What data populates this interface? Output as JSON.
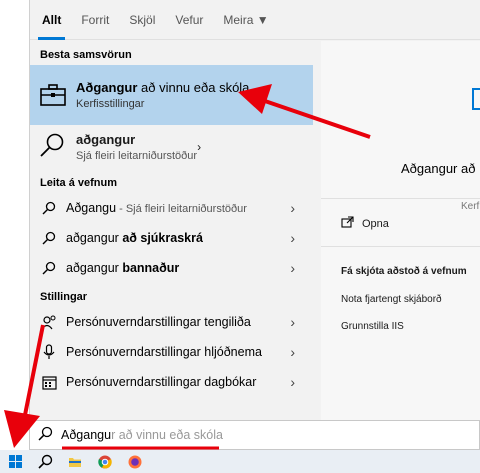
{
  "tabs": [
    {
      "label": "Allt",
      "active": true
    },
    {
      "label": "Forrit",
      "active": false
    },
    {
      "label": "Skjöl",
      "active": false
    },
    {
      "label": "Vefur",
      "active": false
    },
    {
      "label": "Meira ▼",
      "active": false
    }
  ],
  "best_match": {
    "section": "Besta samsvörun",
    "title_bold": "Aðgangur",
    "title_rest": " að vinnu eða skóla",
    "subtitle": "Kerfisstillingar"
  },
  "first_result": {
    "title": "aðgangur",
    "subtitle": "Sjá fleiri leitarniðurstöður"
  },
  "web": {
    "section": "Leita á vefnum",
    "items": [
      {
        "main": "Aðgangu",
        "extra": " - Sjá fleiri leitarniðurstöður"
      },
      {
        "main": "aðgangur ",
        "bold": "að sjúkraskrá"
      },
      {
        "main": "aðgangur ",
        "bold": "bannaður"
      }
    ]
  },
  "settings": {
    "section": "Stillingar",
    "items": [
      {
        "label": "Persónuverndarstillingar tengiliða",
        "icon": "contacts-icon"
      },
      {
        "label": "Persónuverndarstillingar hljóðnema",
        "icon": "microphone-icon"
      },
      {
        "label": "Persónuverndarstillingar dagbókar",
        "icon": "calendar-icon"
      }
    ]
  },
  "preview": {
    "title": "Aðgangur að",
    "subtitle": "Kerfi",
    "open": "Opna",
    "web_header": "Fá skjóta aðstoð á vefnum",
    "links": [
      "Nota fjartengt skjáborð",
      "Grunnstilla IIS"
    ]
  },
  "search": {
    "typed": "Aðgangu",
    "suggestion": "r að vinnu eða skóla"
  },
  "colors": {
    "accent": "#0078d4",
    "highlight": "#b3d3ed",
    "annotation": "#e8000b"
  }
}
